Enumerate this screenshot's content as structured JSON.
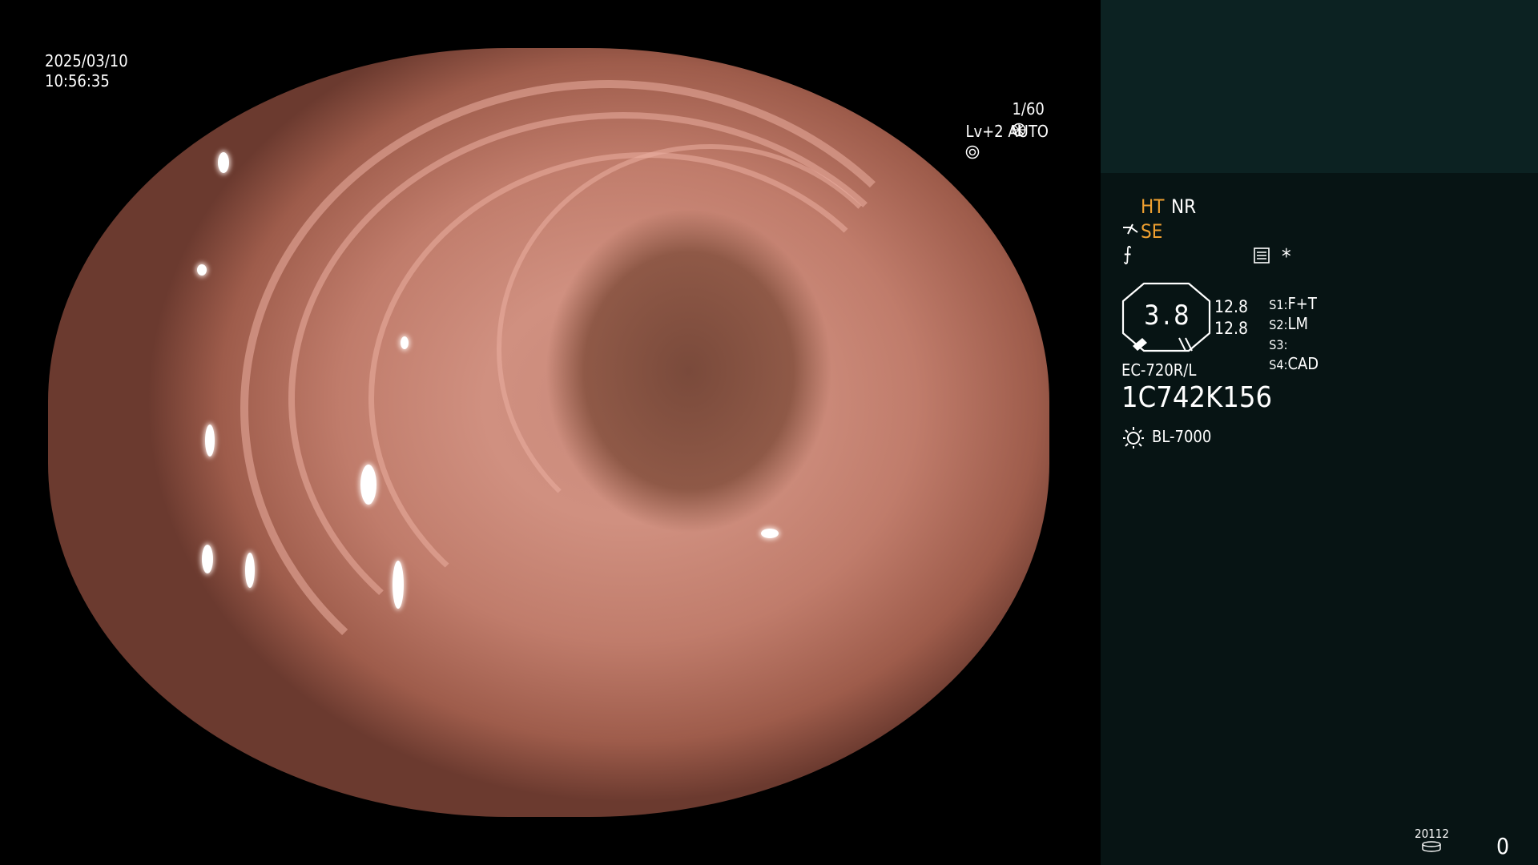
{
  "osd": {
    "date": "2025/03/10",
    "time": "10:56:35",
    "shutter": "1/60",
    "iris": "Lv+2 AUTO"
  },
  "panel": {
    "ht_label": "HT",
    "nr_label": "NR",
    "se_label": "SE",
    "f_symbol": "⨍",
    "asterisk": "*",
    "zoom_value": "3.8",
    "dist_top": "12.8",
    "dist_bottom": "12.8",
    "switches": [
      {
        "key": "S1:",
        "value": "F+T"
      },
      {
        "key": "S2:",
        "value": "LM"
      },
      {
        "key": "S3:",
        "value": ""
      },
      {
        "key": "S4:",
        "value": "CAD"
      }
    ],
    "scope_model": "EC-720R/L",
    "scope_serial": "1C742K156",
    "light_source": "BL-7000",
    "counter_small": "20112",
    "counter_big": "0"
  },
  "colors": {
    "accent_orange": "#f0a030",
    "panel_bg": "#071414",
    "panel_top_bg": "#0c2222"
  },
  "icons": [
    "aperture-icon",
    "iris-icon",
    "scope-connector-icon",
    "memo-icon",
    "light-source-icon",
    "media-icon"
  ]
}
